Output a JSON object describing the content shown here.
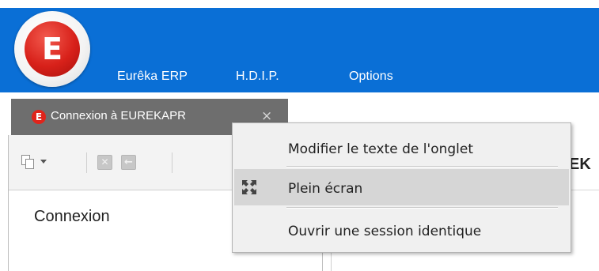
{
  "header": {
    "logo_letter": "E",
    "menu": [
      "Eurêka ERP",
      "H.D.I.P.",
      "Options"
    ]
  },
  "tabs": [
    {
      "label": "Connexion à EUREKAPR",
      "badge": "E",
      "close": "×",
      "active": true
    }
  ],
  "left_pane": {
    "title": "Connexion",
    "toolbar_icons": [
      "copy-icon",
      "dropdown-caret-icon",
      "close-icon",
      "back-arrow-icon"
    ]
  },
  "right_pane": {
    "title_fragment": "EK"
  },
  "context_menu": {
    "items": [
      {
        "label": "Modifier le texte de l'onglet",
        "icon": ""
      },
      {
        "label": "Plein écran",
        "icon": "fullscreen-icon",
        "highlighted": true
      },
      {
        "label": "Ouvrir une session identique",
        "icon": ""
      }
    ]
  },
  "colors": {
    "header_blue": "#0a6fd6",
    "tab_gray": "#6e6e6e",
    "logo_red": "#d8211a",
    "menu_bg": "#f0f0f0",
    "menu_highlight": "#d6d6d6"
  }
}
